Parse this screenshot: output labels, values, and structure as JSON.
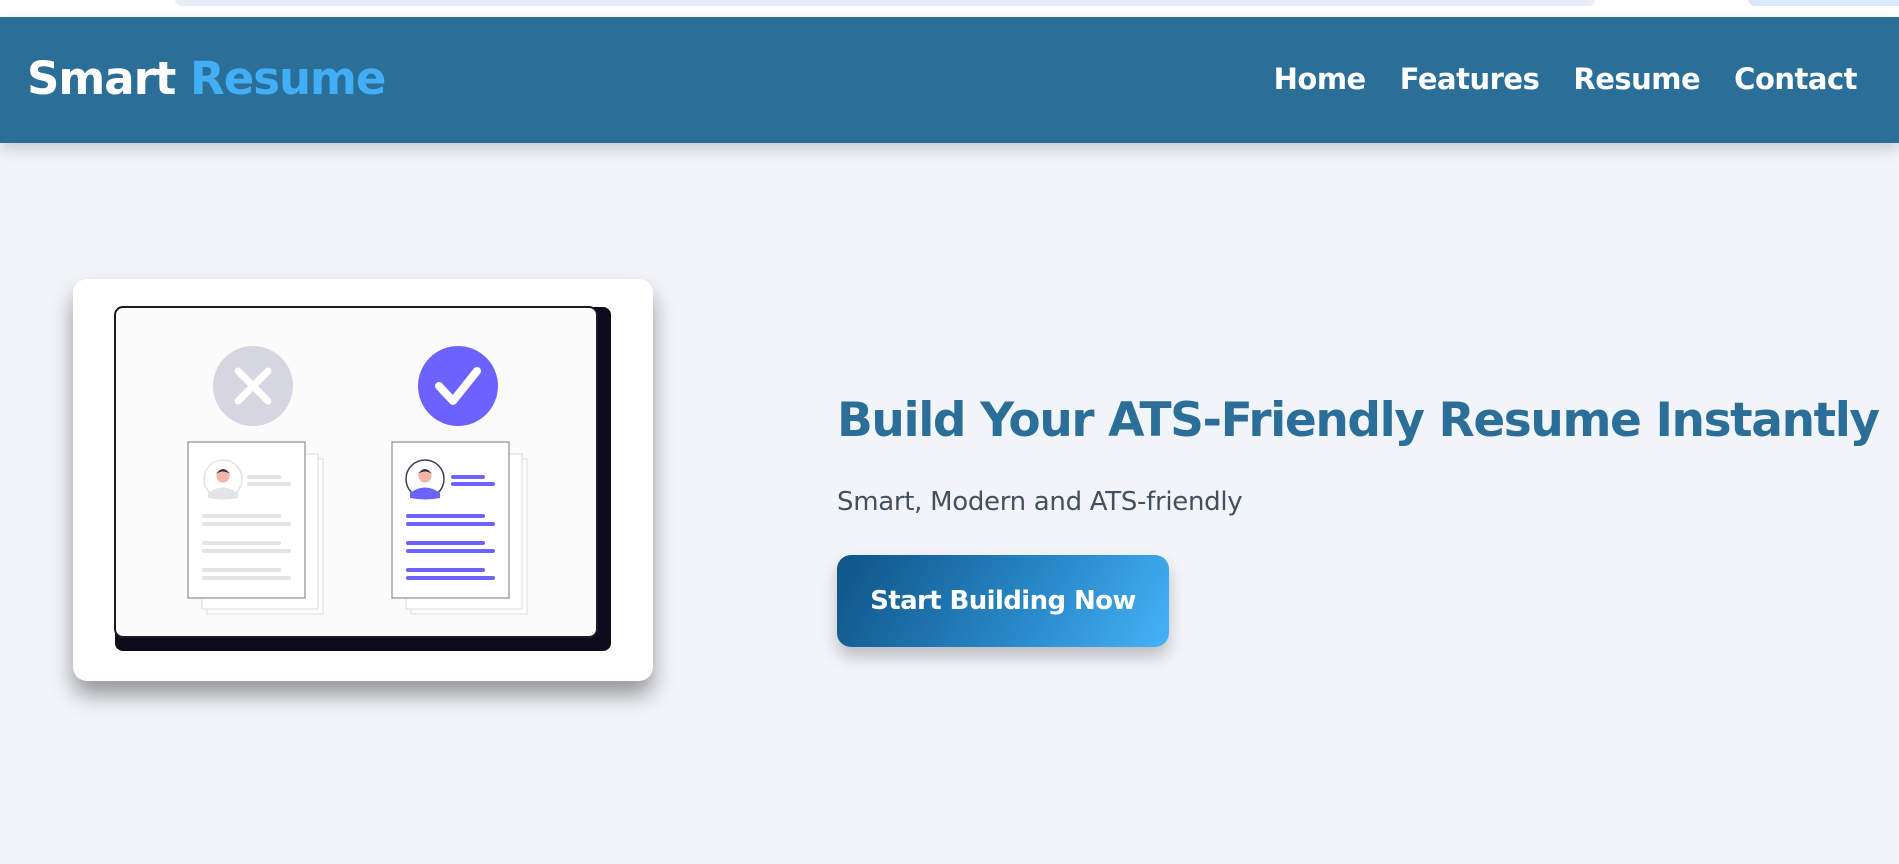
{
  "brand": {
    "part1": "Smart",
    "part2": "Resume",
    "accent_color": "#42aef5"
  },
  "nav": {
    "items": [
      {
        "label": "Home"
      },
      {
        "label": "Features"
      },
      {
        "label": "Resume"
      },
      {
        "label": "Contact"
      }
    ]
  },
  "hero": {
    "title": "Build Your ATS-Friendly Resume Instantly",
    "subtitle": "Smart, Modern and ATS-friendly",
    "cta_label": "Start Building Now",
    "illustration": {
      "rejected_icon": "close-icon",
      "approved_icon": "checkmark-icon",
      "accent_color": "#6c63ff"
    }
  },
  "colors": {
    "header_bg": "#2b6f98",
    "page_bg": "#f1f5f9",
    "title": "#2b6f98"
  }
}
